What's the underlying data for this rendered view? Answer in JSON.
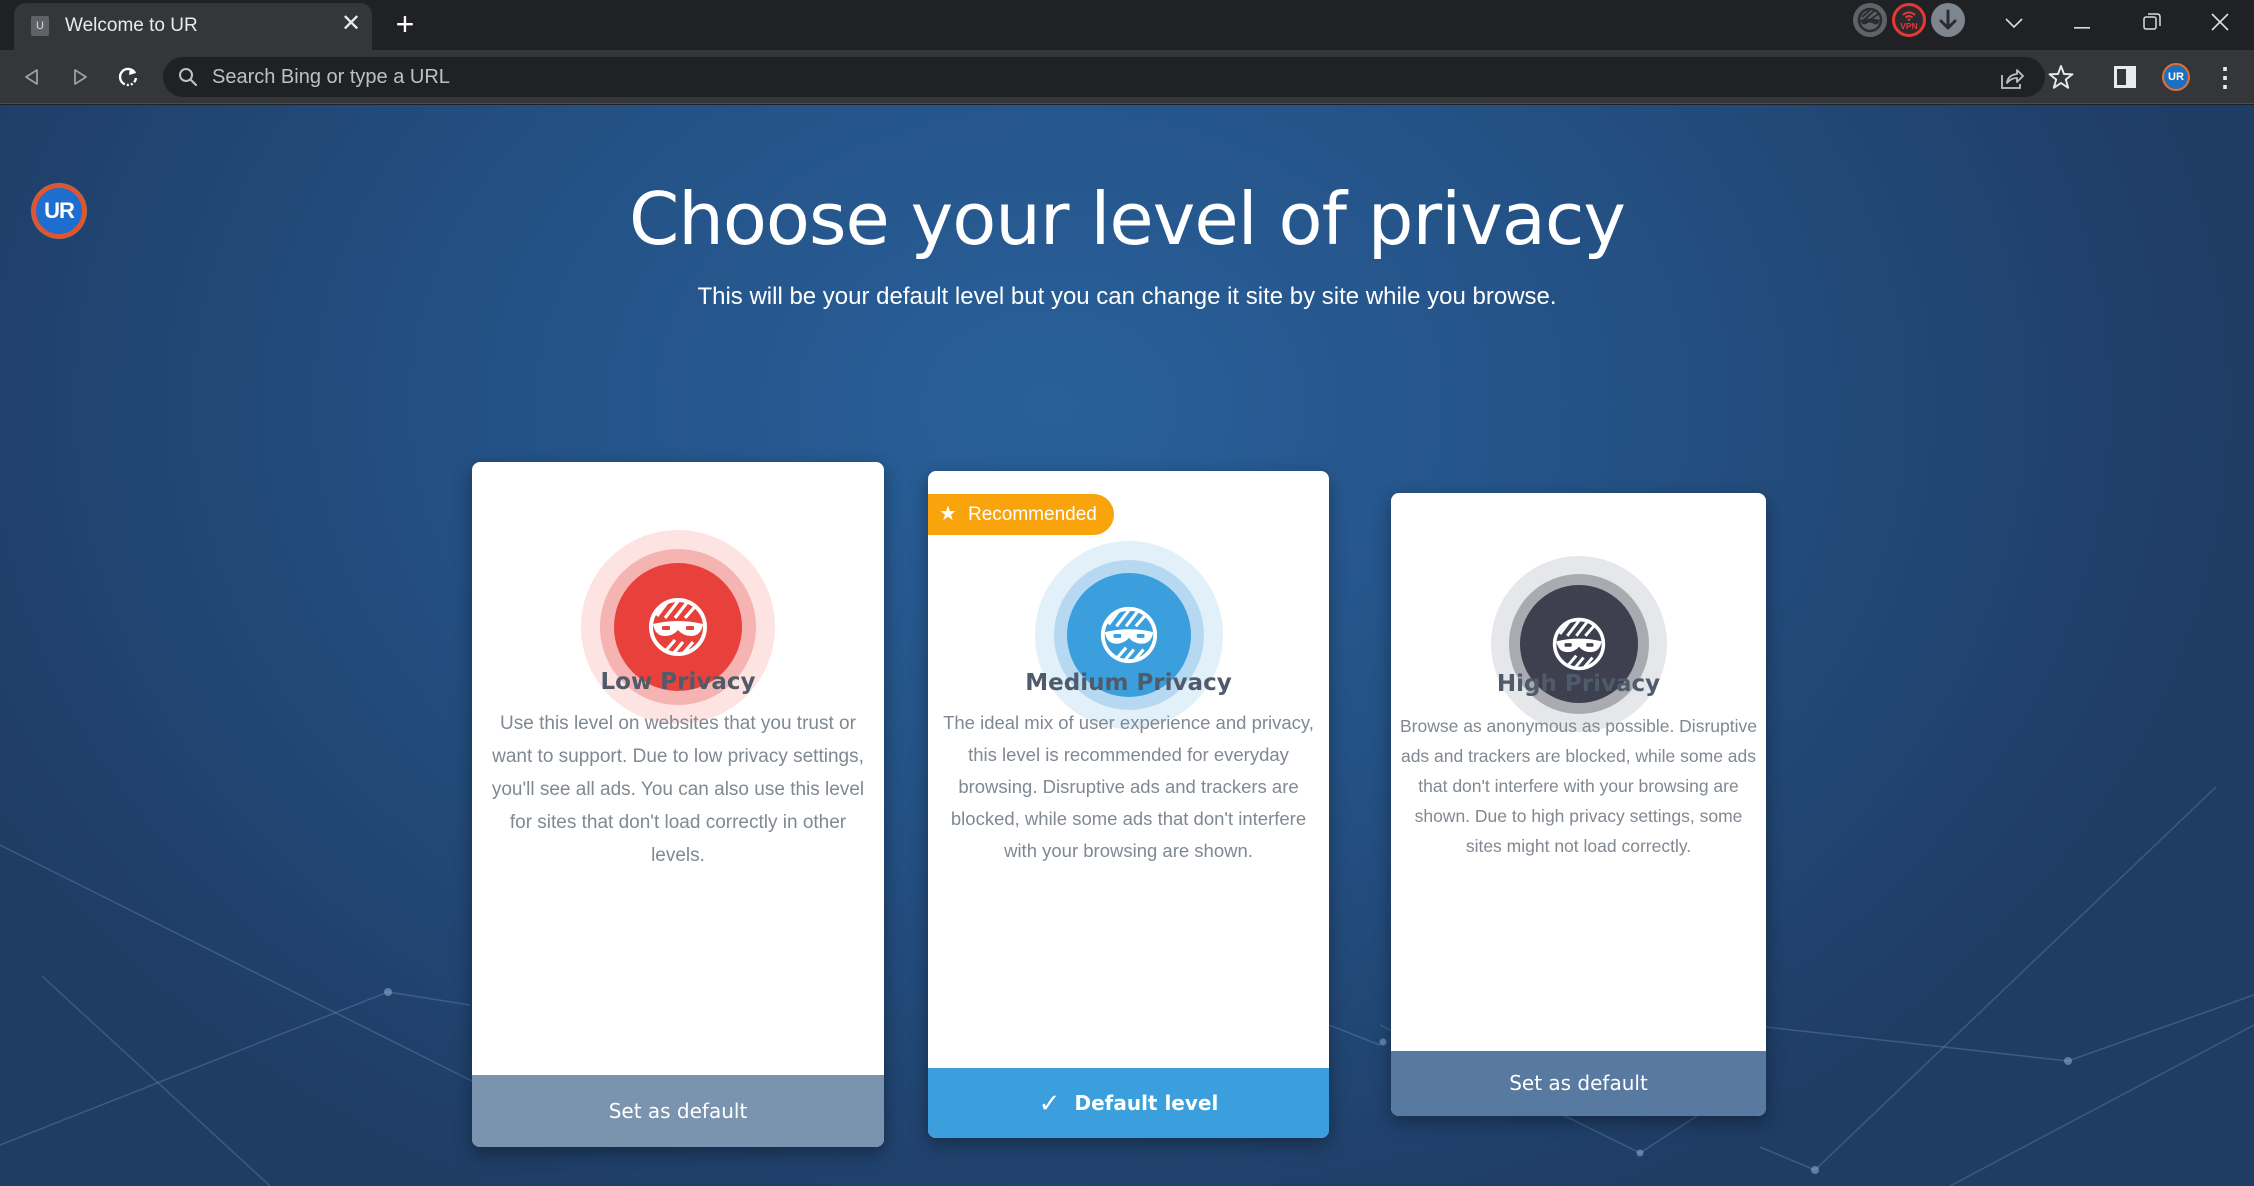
{
  "browser": {
    "tab": {
      "favicon_letter": "U",
      "title": "Welcome to UR",
      "close_glyph": "✕"
    },
    "new_tab_glyph": "+",
    "extensions": [
      {
        "name": "incognito-mask",
        "label": ""
      },
      {
        "name": "vpn",
        "label": "VPN"
      },
      {
        "name": "download",
        "label": ""
      }
    ],
    "window_controls": {
      "tab_search": "⌄",
      "minimize": "—",
      "restore": "❐",
      "close": "✕"
    },
    "nav": {
      "back": "◁",
      "forward": "▷",
      "reload": "↻"
    },
    "omnibox": {
      "placeholder": "Search Bing or type a URL",
      "value": ""
    },
    "profile_label": "UR",
    "menu_glyph": "⋮"
  },
  "page": {
    "logo_text": "UR",
    "title": "Choose your level of privacy",
    "subtitle": "This will be your default level but you can change it site by site while you browse.",
    "cards": [
      {
        "id": "low",
        "title": "Low Privacy",
        "description": "Use this level on websites that you trust or want to support. Due to low privacy settings, you'll see all ads. You can also use this level for sites that don't load correctly in other levels.",
        "button_label": "Set as default",
        "is_default": false,
        "recommended": false,
        "colors": {
          "core": "#e8403a",
          "mid": "#f5b3b1",
          "outer": "#fde3e2",
          "button": "#7a93ae"
        }
      },
      {
        "id": "medium",
        "title": "Medium Privacy",
        "description": "The ideal mix of user experience and privacy, this level is recommended for everyday browsing. Disruptive ads and trackers are blocked, while some ads that don't interfere with your browsing are shown.",
        "button_label": "Default level",
        "button_icon": "✓",
        "is_default": true,
        "recommended": true,
        "badge_label": "Recommended",
        "badge_icon": "★",
        "colors": {
          "core": "#3a9fdc",
          "mid": "#b6d9f1",
          "outer": "#e2f0fa",
          "button": "#3a9fdc",
          "badge": "#f9a40c"
        }
      },
      {
        "id": "high",
        "title": "High Privacy",
        "description": "Browse as anonymous as possible. Disruptive ads and trackers are blocked, while some ads that don't interfere with your browsing are shown. Due to high privacy settings, some sites might not load correctly.",
        "button_label": "Set as default",
        "is_default": false,
        "recommended": false,
        "colors": {
          "core": "#3e3f4f",
          "mid": "#a9abb1",
          "outer": "#e6e7ea",
          "button": "#5879a0"
        }
      }
    ]
  }
}
